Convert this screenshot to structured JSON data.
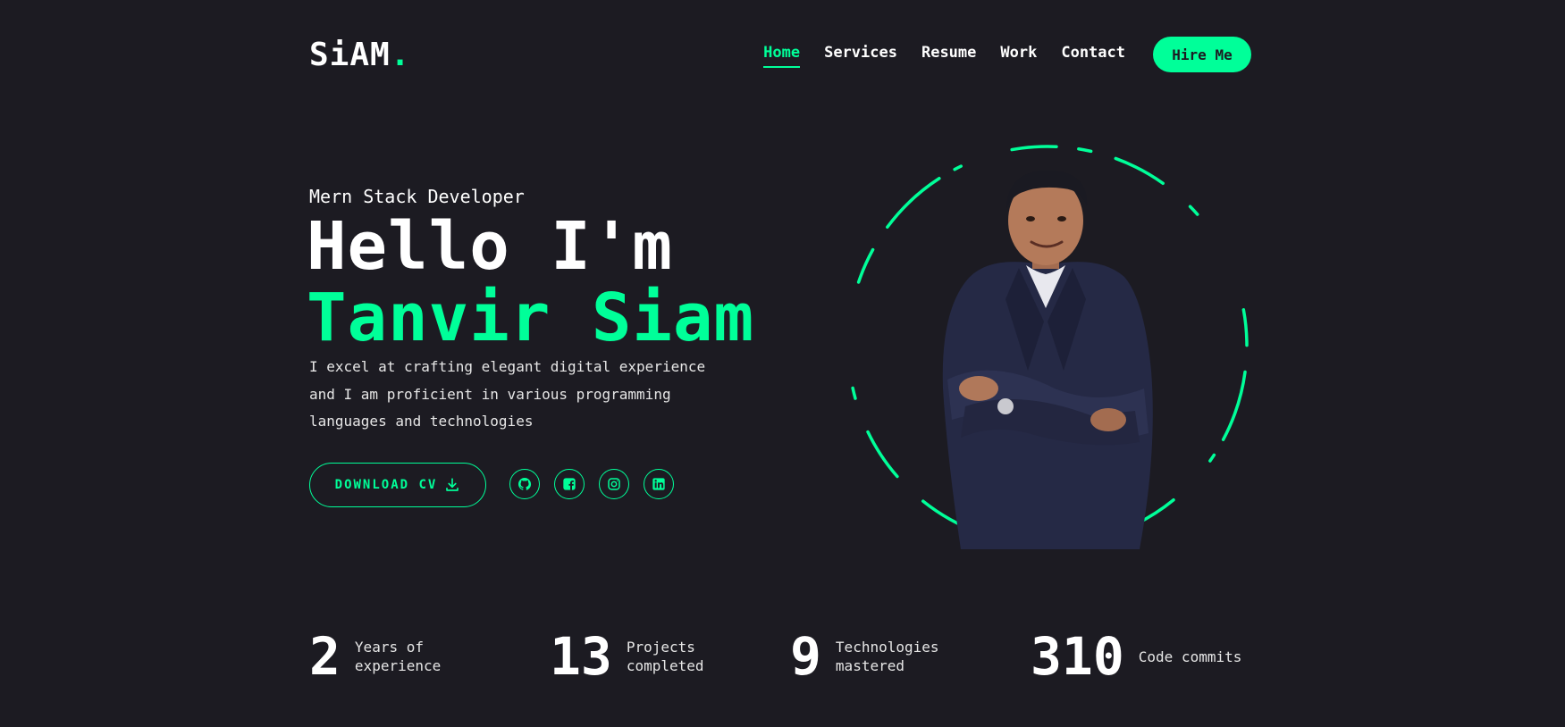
{
  "header": {
    "logo_text": "SiAM",
    "logo_dot": ".",
    "nav": [
      {
        "label": "Home",
        "active": true
      },
      {
        "label": "Services",
        "active": false
      },
      {
        "label": "Resume",
        "active": false
      },
      {
        "label": "Work",
        "active": false
      },
      {
        "label": "Contact",
        "active": false
      }
    ],
    "hire_label": "Hire Me"
  },
  "hero": {
    "subtitle": "Mern Stack Developer",
    "greeting": "Hello I'm",
    "name": "Tanvir Siam",
    "description": "I excel at crafting elegant digital experience and I am proficient in various programming languages and technologies",
    "cv_label": "DOWNLOAD CV",
    "download_icon": "download-icon",
    "socials": [
      {
        "icon": "github-icon"
      },
      {
        "icon": "facebook-icon"
      },
      {
        "icon": "instagram-icon"
      },
      {
        "icon": "linkedin-icon"
      }
    ]
  },
  "stats": [
    {
      "number": "2",
      "label": "Years of experience"
    },
    {
      "number": "13",
      "label": "Projects completed"
    },
    {
      "number": "9",
      "label": "Technologies mastered"
    },
    {
      "number": "310",
      "label": "Code commits"
    }
  ],
  "colors": {
    "background": "#1c1b22",
    "accent": "#00ff99",
    "text": "#ffffff"
  }
}
